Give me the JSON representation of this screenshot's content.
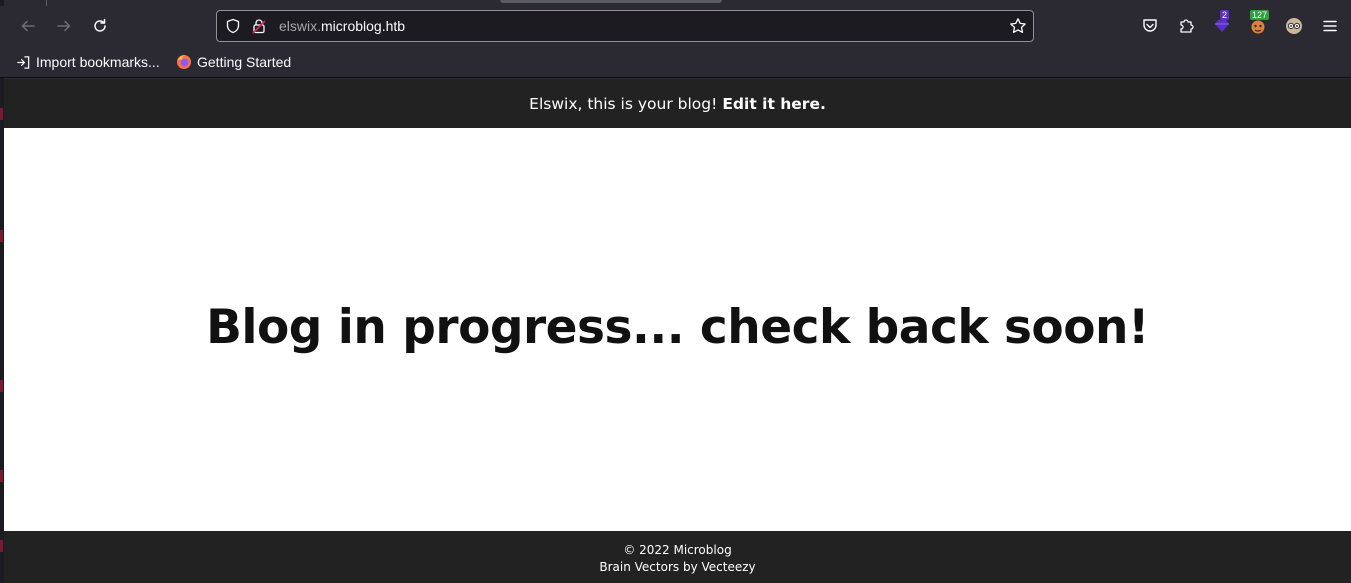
{
  "browser": {
    "url_host_prefix": "elswix.",
    "url_host_main": "microblog.htb",
    "icons": {
      "back": "back-arrow-icon",
      "forward": "forward-arrow-icon",
      "reload": "reload-icon",
      "shield": "tracking-protection-shield-icon",
      "lock": "insecure-lock-icon",
      "bookmark_star": "bookmark-star-icon",
      "pocket": "pocket-icon",
      "extensions": "extensions-puzzle-icon",
      "menu": "hamburger-menu-icon"
    },
    "extensions": [
      {
        "name": "extension-purple",
        "badge": "2",
        "badge_color": "#5b2fc9"
      },
      {
        "name": "extension-fox",
        "badge": "127",
        "badge_color": "#2e9e3e"
      },
      {
        "name": "extension-glasses",
        "badge": ""
      }
    ]
  },
  "bookmarks": {
    "import_label": "Import bookmarks...",
    "getting_started_label": "Getting Started"
  },
  "page": {
    "header_text": "Elswix, this is your blog!",
    "header_link": "Edit it here.",
    "hero_text": "Blog in progress... check back soon!",
    "footer_line1": "© 2022 Microblog",
    "footer_line2": "Brain Vectors by Vecteezy"
  },
  "colors": {
    "chrome_bg": "#2b2a33",
    "page_bar_bg": "#222222",
    "page_bg": "#ffffff"
  }
}
